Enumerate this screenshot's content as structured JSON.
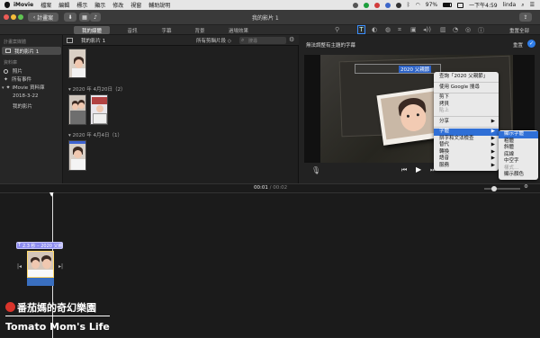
{
  "menubar": {
    "apple": "",
    "app": "iMovie",
    "items": [
      "檔案",
      "編輯",
      "標示",
      "顯示",
      "修改",
      "視窗",
      "輔助說明"
    ],
    "battery": "97%",
    "clock": "一下午4:59",
    "user": "linda"
  },
  "toolbar": {
    "back_button": "計畫案",
    "title": "我的影片 1",
    "reset_all": "重置全部"
  },
  "tabs": [
    {
      "label": "我的媒體",
      "active": true
    },
    {
      "label": "音訊",
      "active": false
    },
    {
      "label": "字幕",
      "active": false
    },
    {
      "label": "背景",
      "active": false
    },
    {
      "label": "過場效果",
      "active": false
    }
  ],
  "sidebar": {
    "section1": "計畫案媒體",
    "project": "我的影片 1",
    "section2": "資料庫",
    "photos": "照片",
    "all_events": "所有事件",
    "library": "iMovie 資料庫",
    "event1": "2018-3-22",
    "event2": "我的影片"
  },
  "browser": {
    "title": "我的影片 1",
    "filter": "所有剪輯片段",
    "search_placeholder": "搜尋",
    "groups": [
      {
        "date": "2020 年 4月20日（2）"
      },
      {
        "date": "2020 年 4月4日（1）"
      }
    ]
  },
  "viewer": {
    "status": "無法調整有主題的字幕",
    "reset_button": "重置",
    "title_text": "2020 父親節"
  },
  "context_menu": {
    "items": [
      {
        "label": "查詢「2020 父親節」",
        "type": "item"
      },
      {
        "type": "sep"
      },
      {
        "label": "使用 Google 搜尋",
        "type": "item"
      },
      {
        "type": "sep"
      },
      {
        "label": "剪下",
        "type": "item"
      },
      {
        "label": "拷貝",
        "type": "item"
      },
      {
        "label": "貼上",
        "type": "disabled"
      },
      {
        "type": "sep"
      },
      {
        "label": "分享",
        "type": "sub"
      },
      {
        "type": "sep"
      },
      {
        "label": "字體",
        "type": "highlight"
      },
      {
        "label": "拼字和文法檢查",
        "type": "sub"
      },
      {
        "label": "替代",
        "type": "sub"
      },
      {
        "label": "轉換",
        "type": "sub"
      },
      {
        "label": "語音",
        "type": "sub"
      },
      {
        "label": "服務",
        "type": "sub"
      }
    ]
  },
  "font_submenu": {
    "items": [
      {
        "label": "顯示字體",
        "type": "highlight"
      },
      {
        "label": "粗體",
        "type": "item"
      },
      {
        "label": "斜體",
        "type": "item"
      },
      {
        "label": "底線",
        "type": "item"
      },
      {
        "label": "中空字",
        "type": "item"
      },
      {
        "label": "樣式…",
        "type": "disabled"
      },
      {
        "label": "顯示顏色",
        "type": "item"
      }
    ]
  },
  "timeline": {
    "current_time": "00:01",
    "separator": "/",
    "total_time": "00:02",
    "title_clip": "2.3 秒 – 2020 父親節"
  },
  "watermark": {
    "line1": "番茄媽的奇幻樂園",
    "line2": "Tomato Mom's Life"
  },
  "colors": {
    "accent": "#2f6fd6",
    "title_clip": "#8d8cf0",
    "video_clip": "#3a6fbf",
    "watermark_dot": "#d9342b"
  }
}
